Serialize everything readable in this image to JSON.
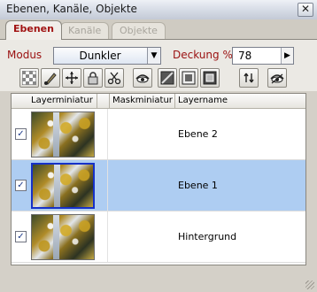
{
  "window": {
    "title": "Ebenen, Kanäle, Objekte"
  },
  "tabs": [
    {
      "label": "Ebenen",
      "active": true
    },
    {
      "label": "Kanäle",
      "active": false
    },
    {
      "label": "Objekte",
      "active": false
    }
  ],
  "toolbar": {
    "mode_label": "Modus",
    "mode_value": "Dunkler",
    "opacity_label": "Deckung %",
    "opacity_value": "78",
    "buttons": [
      "checkerboard-icon",
      "brush-icon",
      "crossed-arrows-icon",
      "lock-icon",
      "scissors-icon",
      "eye-icon",
      "image-placeholder-icon",
      "image-frame-icon",
      "layers-copy-icon",
      "flip-arrows-icon",
      "eye-strike-icon"
    ]
  },
  "table": {
    "headers": {
      "thumbnail": "Layerminiatur",
      "mask": "Maskminiatur",
      "name": "Layername"
    },
    "rows": [
      {
        "name": "Ebene 2",
        "visible": true,
        "selected": false
      },
      {
        "name": "Ebene 1",
        "visible": true,
        "selected": true
      },
      {
        "name": "Hintergrund",
        "visible": true,
        "selected": false
      }
    ]
  },
  "colors": {
    "accent_red": "#a11414",
    "selection_blue": "#aecdf2",
    "selection_border": "#1631c8"
  }
}
